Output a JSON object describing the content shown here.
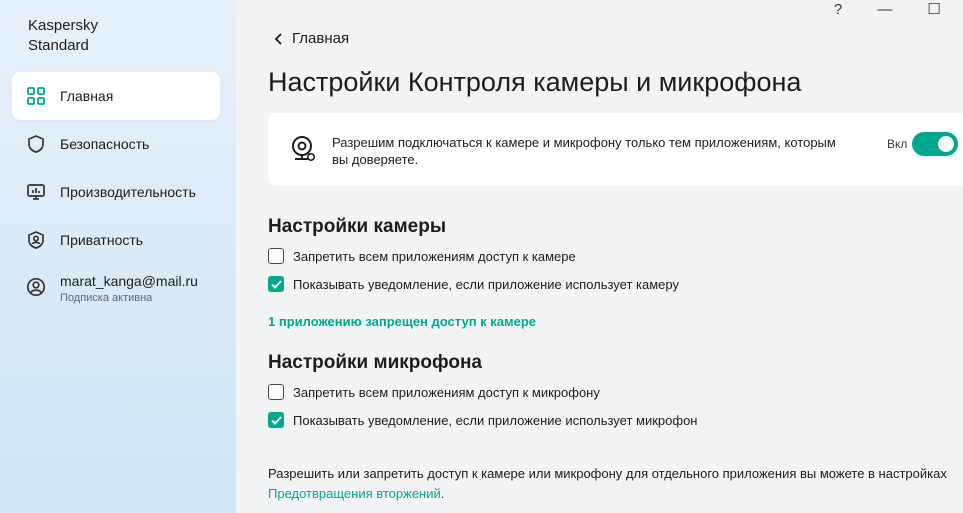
{
  "app": {
    "brand_line1": "Kaspersky",
    "brand_line2": "Standard"
  },
  "window": {
    "help": "?",
    "minimize": "—",
    "maximize": "☐"
  },
  "sidebar": {
    "items": [
      {
        "label": "Главная",
        "icon": "home-grid-icon",
        "active": true
      },
      {
        "label": "Безопасность",
        "icon": "shield-icon",
        "active": false
      },
      {
        "label": "Производительность",
        "icon": "monitor-icon",
        "active": false
      },
      {
        "label": "Приватность",
        "icon": "privacy-shield-icon",
        "active": false
      }
    ],
    "account": {
      "email": "marat_kanga@mail.ru",
      "status": "Подписка активна",
      "icon": "user-icon"
    }
  },
  "header": {
    "back_label": "Главная",
    "title": "Настройки Контроля камеры и микрофона"
  },
  "feature_card": {
    "description": "Разрешим подключаться к камере и микрофону только тем приложениям, которым вы доверяете.",
    "state_label": "Вкл",
    "enabled": true,
    "icon": "webcam-icon"
  },
  "camera": {
    "heading": "Настройки камеры",
    "options": [
      {
        "label": "Запретить всем приложениям доступ к камере",
        "checked": false
      },
      {
        "label": "Показывать уведомление, если приложение использует камеру",
        "checked": true
      }
    ],
    "blocked_link": "1 приложению запрещен доступ к камере"
  },
  "microphone": {
    "heading": "Настройки микрофона",
    "options": [
      {
        "label": "Запретить всем приложениям доступ к микрофону",
        "checked": false
      },
      {
        "label": "Показывать уведомление, если приложение использует микрофон",
        "checked": true
      }
    ]
  },
  "footer_note": {
    "text_before": "Разрешить или запретить доступ к камере или микрофону для отдельного приложения вы можете в настройках ",
    "link": "Предотвращения вторжений",
    "text_after": "."
  },
  "colors": {
    "accent": "#00a88e",
    "sidebar_bg": "#d9eaf7",
    "page_bg": "#f2f3f4"
  }
}
